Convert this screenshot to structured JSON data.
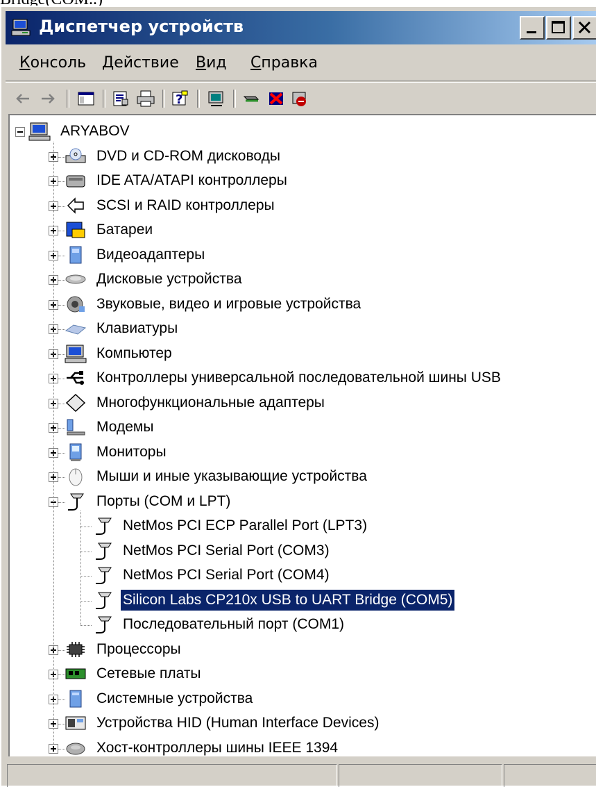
{
  "window": {
    "title": "Диспетчер устройств",
    "top_cut_text": "Bridge(COM..)"
  },
  "menu": [
    {
      "accel": "К",
      "rest": "онсоль"
    },
    {
      "accel": "Д",
      "rest": "ействие"
    },
    {
      "accel": "В",
      "rest": "ид"
    },
    {
      "accel": "С",
      "rest": "правка"
    }
  ],
  "toolbar_icons": [
    "back-arrow-icon",
    "forward-arrow-icon",
    "console-tree-icon",
    "properties-icon",
    "print-icon",
    "help-icon",
    "scan-hardware-icon",
    "update-driver-icon",
    "disable-device-icon",
    "uninstall-device-icon"
  ],
  "tree": {
    "root": "ARYABOV",
    "categories": [
      {
        "label": "DVD и CD-ROM дисководы",
        "icon": "cdrom-icon"
      },
      {
        "label": "IDE ATA/ATAPI контроллеры",
        "icon": "ide-controller-icon"
      },
      {
        "label": "SCSI и RAID контроллеры",
        "icon": "scsi-icon"
      },
      {
        "label": "Батареи",
        "icon": "battery-icon"
      },
      {
        "label": "Видеоадаптеры",
        "icon": "display-adapter-icon"
      },
      {
        "label": "Дисковые устройства",
        "icon": "disk-drive-icon"
      },
      {
        "label": "Звуковые, видео и игровые устройства",
        "icon": "sound-icon"
      },
      {
        "label": "Клавиатуры",
        "icon": "keyboard-icon"
      },
      {
        "label": "Компьютер",
        "icon": "computer-icon"
      },
      {
        "label": "Контроллеры универсальной последовательной шины USB",
        "icon": "usb-icon"
      },
      {
        "label": "Многофункциональные адаптеры",
        "icon": "multifunction-icon"
      },
      {
        "label": "Модемы",
        "icon": "modem-icon"
      },
      {
        "label": "Мониторы",
        "icon": "monitor-icon"
      },
      {
        "label": "Мыши и иные указывающие устройства",
        "icon": "mouse-icon"
      },
      {
        "label": "Порты (COM и LPT)",
        "icon": "port-icon",
        "expanded": true
      },
      {
        "label": "Процессоры",
        "icon": "processor-icon"
      },
      {
        "label": "Сетевые платы",
        "icon": "network-card-icon"
      },
      {
        "label": "Системные устройства",
        "icon": "system-device-icon"
      },
      {
        "label": "Устройства HID (Human Interface Devices)",
        "icon": "hid-icon"
      },
      {
        "label": "Хост-контроллеры шины IEEE 1394",
        "icon": "ieee1394-icon"
      }
    ],
    "ports": [
      {
        "label": "NetMos PCI ECP Parallel Port (LPT3)"
      },
      {
        "label": "NetMos PCI Serial Port (COM3)"
      },
      {
        "label": "NetMos PCI Serial Port (COM4)"
      },
      {
        "label": "Silicon Labs CP210x USB to UART Bridge (COM5)",
        "selected": true
      },
      {
        "label": "Последовательный порт (COM1)"
      }
    ]
  },
  "colors": {
    "title_gradient_start": "#0a246a",
    "title_gradient_end": "#a6caf0",
    "selection": "#0a246a",
    "face": "#d4d0c8"
  }
}
